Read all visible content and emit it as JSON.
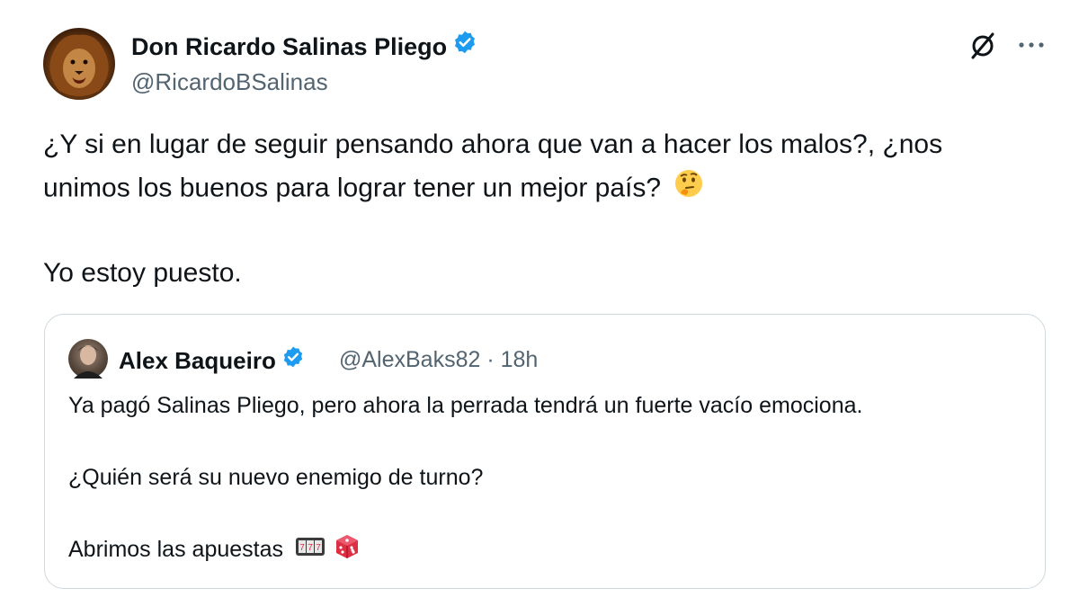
{
  "tweet": {
    "author_name": "Don Ricardo Salinas Pliego",
    "handle": "@RicardoBSalinas",
    "text_line1": "¿Y si en lugar de seguir pensando ahora que van a hacer los malos?, ¿nos",
    "text_line2": "unimos los buenos para lograr tener un mejor país?",
    "text_line3": "Yo estoy puesto.",
    "emoji_1": "thinking-face"
  },
  "quoted": {
    "author_name": "Alex Baqueiro",
    "meta": "@AlexBaks82 · 18h",
    "text_line1": "Ya pagó Salinas Pliego, pero ahora la perrada tendrá un fuerte vacío emociona.",
    "text_line2": "¿Quién será su nuevo enemigo de turno?",
    "text_line3": "Abrimos las apuestas",
    "emoji_1": "slot-machine",
    "emoji_2": "game-die"
  },
  "colors": {
    "verified_blue": "#1d9bf0",
    "text_primary": "#0f1419",
    "text_secondary": "#536471",
    "card_border": "#cfd9de"
  },
  "icons": [
    "grok-icon",
    "more-icon",
    "verified-badge-icon"
  ]
}
